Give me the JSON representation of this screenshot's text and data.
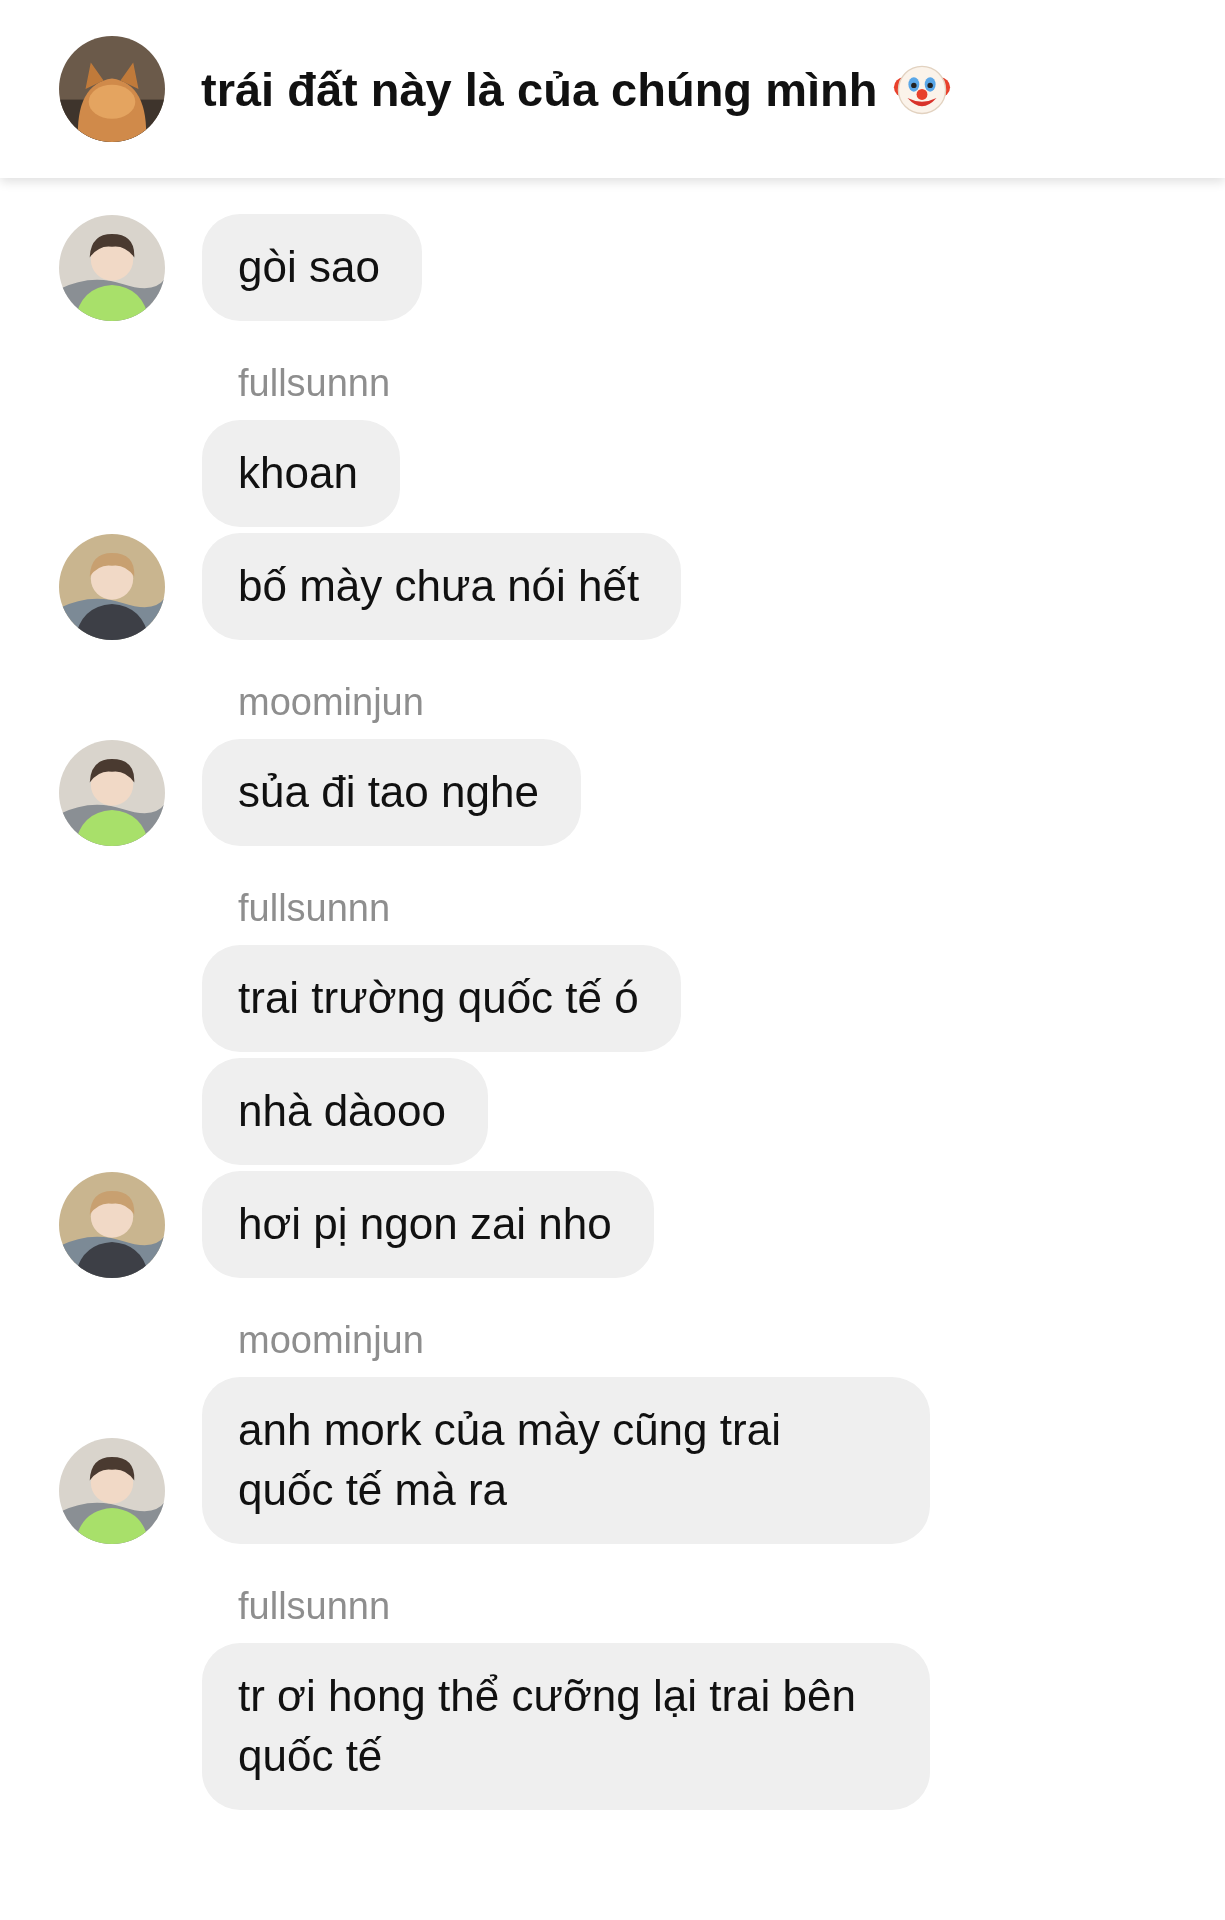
{
  "header": {
    "title": "trái đất này là của chúng mình"
  },
  "groups": [
    {
      "avatar": {
        "kind": "portrait"
      },
      "messages": [
        "gòi sao"
      ]
    },
    {
      "sender": "fullsunnn",
      "avatar": {
        "kind": "outdoor"
      },
      "messages": [
        "khoan",
        "bố mày chưa nói hết"
      ]
    },
    {
      "sender": "moominjun",
      "avatar": {
        "kind": "portrait"
      },
      "messages": [
        "sủa đi tao nghe"
      ]
    },
    {
      "sender": "fullsunnn",
      "avatar": {
        "kind": "outdoor"
      },
      "messages": [
        "trai trường quốc tế ó",
        "nhà dàooo",
        "hơi pị ngon zai nho"
      ]
    },
    {
      "sender": "moominjun",
      "avatar": {
        "kind": "portrait"
      },
      "messages": [
        "anh mork của mày cũng trai quốc tế mà ra"
      ]
    },
    {
      "sender": "fullsunnn",
      "messages": [
        "tr ơi hong thể cưỡng lại trai bên quốc tế"
      ]
    }
  ]
}
